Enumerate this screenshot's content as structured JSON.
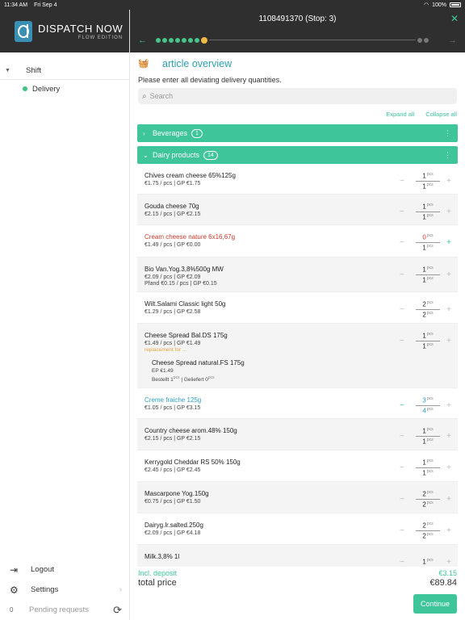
{
  "status": {
    "time": "11:34 AM",
    "date": "Fri Sep 4",
    "battery": "100%"
  },
  "brand": {
    "name": "DISPATCH NOW",
    "sub": "FLOW EDITION"
  },
  "sidebar": {
    "shift": "Shift",
    "delivery": "Delivery",
    "logout": "Logout",
    "settings": "Settings",
    "pending_count": "0",
    "pending": "Pending requests"
  },
  "header": {
    "title": "1108491370 (Stop: 3)"
  },
  "main": {
    "title": "article overview",
    "instruction": "Please enter all deviating delivery quantities.",
    "search_placeholder": "Search",
    "expand_all": "Expand all",
    "collapse_all": "Collapse all"
  },
  "categories": [
    {
      "label": "Beverages",
      "count": "1"
    },
    {
      "label": "Dairy products",
      "count": "14"
    }
  ],
  "items": [
    {
      "name": "Chives cream cheese 65%125g",
      "price": "€1.75 / pcs | GP €1.75",
      "q1": "1",
      "q2": "1",
      "unit": "pcs"
    },
    {
      "name": "Gouda cheese 70g",
      "price": "€2.15 / pcs | GP €2.15",
      "q1": "1",
      "q2": "1",
      "unit": "pcs"
    },
    {
      "name": "Cream cheese nature 6x16,67g",
      "price": "€1.49 / pcs | GP €0.00",
      "q1": "0",
      "q2": "1",
      "unit": "pcs"
    },
    {
      "name": "Bio Van.Yog.3,8%500g MW",
      "price": "€2.09 / pcs | GP €2.09",
      "price2": "Pfand €0.15 / pcs | GP €0.15",
      "q1": "1",
      "q2": "1",
      "unit": "pcs"
    },
    {
      "name": "Wilt.Salami Classic light 50g",
      "price": "€1.29 / pcs | GP €2.58",
      "q1": "2",
      "q2": "2",
      "unit": "pcs"
    },
    {
      "name": "Cheese Spread Bal.DS 175g",
      "price": "€1.49 / pcs | GP €1.49",
      "replacement": "replacement for ...",
      "sub_name": "Cheese Spread natural.FS 175g",
      "sub_ep": "EP €1.49",
      "sub_line_a": "Bestellt 1",
      "sub_line_b": "| Geliefert 0",
      "q1": "1",
      "q2": "1",
      "unit": "pcs"
    },
    {
      "name": "Creme fraiche 125g",
      "price": "€1.05 / pcs | GP €3.15",
      "q1": "3",
      "q2": "4",
      "unit": "pcs"
    },
    {
      "name": "Country cheese arom.48% 150g",
      "price": "€2.15 / pcs | GP €2.15",
      "q1": "1",
      "q2": "1",
      "unit": "pcs"
    },
    {
      "name": "Kerrygold Cheddar RS 50% 150g",
      "price": "€2.45 / pcs | GP €2.45",
      "q1": "1",
      "q2": "1",
      "unit": "pcs"
    },
    {
      "name": "Mascarpone Yog.150g",
      "price": "€0.75 / pcs | GP €1.50",
      "q1": "2",
      "q2": "2",
      "unit": "pcs"
    },
    {
      "name": "Dairyg.lr.salted.250g",
      "price": "€2.09 / pcs | GP €4.18",
      "q1": "2",
      "q2": "2",
      "unit": "pcs"
    },
    {
      "name": "Milk.3,8% 1l",
      "q1": "1",
      "unit": "pcs"
    }
  ],
  "footer": {
    "deposit_label": "Incl. deposit",
    "deposit_value": "€3.15",
    "total_label": "total price",
    "total_value": "€89.84",
    "continue": "Continue"
  }
}
